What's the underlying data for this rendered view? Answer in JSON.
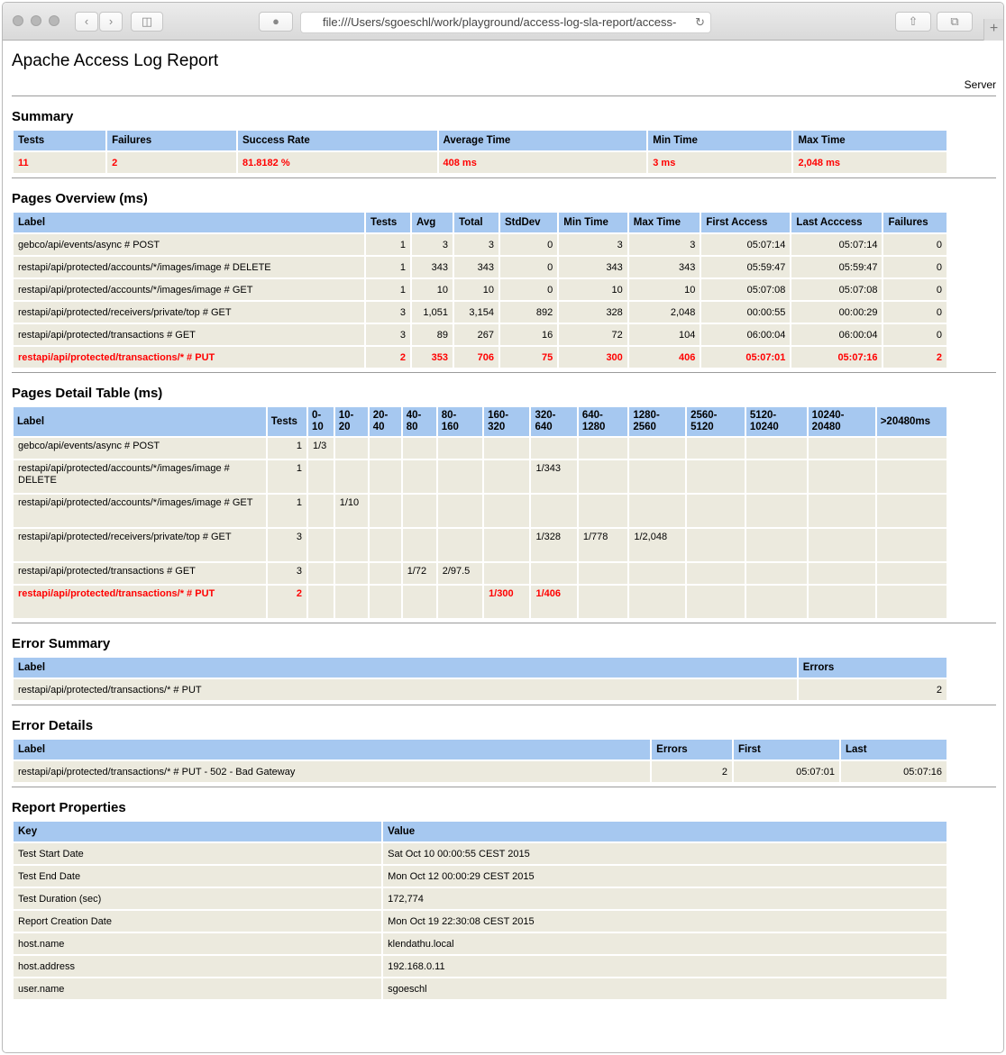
{
  "browser": {
    "url": "file:///Users/sgoeschl/work/playground/access-log-sla-report/access-",
    "reload": "↻"
  },
  "report": {
    "title": "Apache Access Log Report",
    "subtitle": "Server"
  },
  "summary": {
    "heading": "Summary",
    "headers": [
      "Tests",
      "Failures",
      "Success Rate",
      "Average Time",
      "Min Time",
      "Max Time"
    ],
    "values": [
      "11",
      "2",
      "81.8182 %",
      "408 ms",
      "3 ms",
      "2,048 ms"
    ]
  },
  "overview": {
    "heading": "Pages Overview (ms)",
    "headers": [
      "Label",
      "Tests",
      "Avg",
      "Total",
      "StdDev",
      "Min Time",
      "Max Time",
      "First Access",
      "Last Acccess",
      "Failures"
    ],
    "rows": [
      [
        "gebco/api/events/async # POST",
        "1",
        "3",
        "3",
        "0",
        "3",
        "3",
        "05:07:14",
        "05:07:14",
        "0"
      ],
      [
        "restapi/api/protected/accounts/*/images/image # DELETE",
        "1",
        "343",
        "343",
        "0",
        "343",
        "343",
        "05:59:47",
        "05:59:47",
        "0"
      ],
      [
        "restapi/api/protected/accounts/*/images/image # GET",
        "1",
        "10",
        "10",
        "0",
        "10",
        "10",
        "05:07:08",
        "05:07:08",
        "0"
      ],
      [
        "restapi/api/protected/receivers/private/top # GET",
        "3",
        "1,051",
        "3,154",
        "892",
        "328",
        "2,048",
        "00:00:55",
        "00:00:29",
        "0"
      ],
      [
        "restapi/api/protected/transactions # GET",
        "3",
        "89",
        "267",
        "16",
        "72",
        "104",
        "06:00:04",
        "06:00:04",
        "0"
      ],
      [
        "restapi/api/protected/transactions/* # PUT",
        "2",
        "353",
        "706",
        "75",
        "300",
        "406",
        "05:07:01",
        "05:07:16",
        "2"
      ]
    ]
  },
  "detail": {
    "heading": "Pages Detail Table (ms)",
    "headers": [
      "Label",
      "Tests",
      "0-\n10",
      "10-\n20",
      "20-\n40",
      "40-\n80",
      "80-\n160",
      "160-\n320",
      "320-\n640",
      "640-\n1280",
      "1280-\n2560",
      "2560-\n5120",
      "5120-\n10240",
      "10240-\n20480",
      ">20480ms"
    ],
    "rows": [
      [
        "gebco/api/events/async # POST",
        "1",
        "1/3",
        "",
        "",
        "",
        "",
        "",
        "",
        "",
        "",
        "",
        "",
        "",
        ""
      ],
      [
        "restapi/api/protected/accounts/*/images/image # DELETE",
        "1",
        "",
        "",
        "",
        "",
        "",
        "",
        "1/343",
        "",
        "",
        "",
        "",
        "",
        ""
      ],
      [
        "restapi/api/protected/accounts/*/images/image # GET",
        "1",
        "",
        "1/10",
        "",
        "",
        "",
        "",
        "",
        "",
        "",
        "",
        "",
        "",
        ""
      ],
      [
        "restapi/api/protected/receivers/private/top # GET",
        "3",
        "",
        "",
        "",
        "",
        "",
        "",
        "1/328",
        "1/778",
        "1/2,048",
        "",
        "",
        "",
        ""
      ],
      [
        "restapi/api/protected/transactions # GET",
        "3",
        "",
        "",
        "",
        "1/72",
        "2/97.5",
        "",
        "",
        "",
        "",
        "",
        "",
        "",
        ""
      ],
      [
        "restapi/api/protected/transactions/* # PUT",
        "2",
        "",
        "",
        "",
        "",
        "",
        "1/300",
        "1/406",
        "",
        "",
        "",
        "",
        "",
        ""
      ]
    ]
  },
  "error_summary": {
    "heading": "Error Summary",
    "headers": [
      "Label",
      "Errors"
    ],
    "rows": [
      [
        "restapi/api/protected/transactions/* # PUT",
        "2"
      ]
    ]
  },
  "error_details": {
    "heading": "Error Details",
    "headers": [
      "Label",
      "Errors",
      "First",
      "Last"
    ],
    "rows": [
      [
        "restapi/api/protected/transactions/* # PUT - 502 - Bad Gateway",
        "2",
        "05:07:01",
        "05:07:16"
      ]
    ]
  },
  "properties": {
    "heading": "Report Properties",
    "headers": [
      "Key",
      "Value"
    ],
    "rows": [
      [
        "Test Start Date",
        "Sat Oct 10 00:00:55 CEST 2015"
      ],
      [
        "Test End Date",
        "Mon Oct 12 00:00:29 CEST 2015"
      ],
      [
        "Test Duration (sec)",
        "172,774"
      ],
      [
        "Report Creation Date",
        "Mon Oct 19 22:30:08 CEST 2015"
      ],
      [
        "host.name",
        "klendathu.local"
      ],
      [
        "host.address",
        "192.168.0.11"
      ],
      [
        "user.name",
        "sgoeschl"
      ]
    ]
  },
  "colors": {
    "header_bg": "#a6c8f0",
    "cell_bg": "#eceade",
    "failure": "#ff0000"
  }
}
